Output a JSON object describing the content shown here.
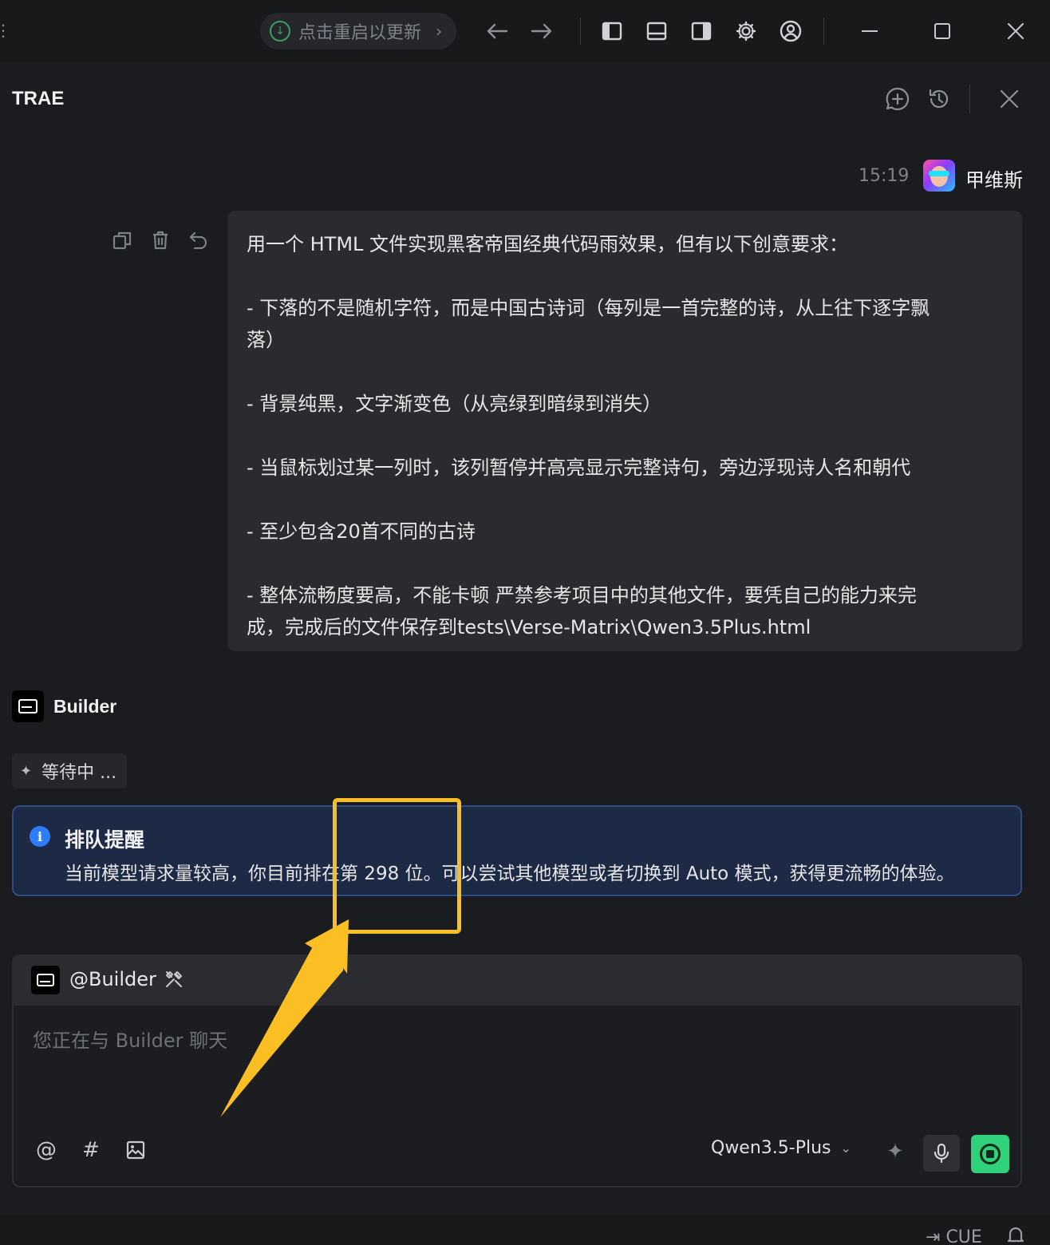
{
  "titlebar": {
    "update_label": "点击重启以更新"
  },
  "panel": {
    "title": "TRAE"
  },
  "user_message": {
    "time": "15:19",
    "user_name": "甲维斯",
    "lines": [
      "用一个 HTML 文件实现黑客帝国经典代码雨效果，但有以下创意要求：",
      "- 下落的不是随机字符，而是中国古诗词（每列是一首完整的诗，从上往下逐字飘",
      "落）",
      "- 背景纯黑，文字渐变色（从亮绿到暗绿到消失）",
      "- 当鼠标划过某一列时，该列暂停并高亮显示完整诗句，旁边浮现诗人名和朝代",
      "- 至少包含20首不同的古诗",
      "- 整体流畅度要高，不能卡顿      严禁参考项目中的其他文件，要凭自己的能力来完",
      "成，完成后的文件保存到tests\\Verse-Matrix\\Qwen3.5Plus.html"
    ]
  },
  "builder": {
    "name": "Builder",
    "status": "等待中 ..."
  },
  "queue_alert": {
    "title": "排队提醒",
    "body": "当前模型请求量较高，你目前排在第 298 位。可以尝试其他模型或者切换到 Auto 模式，获得更流畅的体验。"
  },
  "composer": {
    "mention": "@Builder",
    "placeholder": "您正在与 Builder 聊天",
    "model": "Qwen3.5-Plus"
  },
  "statusbar": {
    "cue_label": "CUE"
  },
  "colors": {
    "accent_green": "#2fd17a",
    "annotation": "#fbbf24",
    "info_blue": "#2e7cf6"
  },
  "icons": [
    "download-icon",
    "arrow-left-icon",
    "arrow-right-icon",
    "layout-left-icon",
    "layout-bottom-icon",
    "layout-right-icon",
    "gear-icon",
    "account-icon",
    "minimize-icon",
    "maximize-icon",
    "close-icon",
    "new-chat-icon",
    "history-icon",
    "copy-icon",
    "trash-icon",
    "undo-icon",
    "info-icon",
    "tools-icon",
    "at-icon",
    "hash-icon",
    "image-icon",
    "sparkle-icon",
    "mic-icon",
    "stop-icon",
    "bell-icon"
  ]
}
